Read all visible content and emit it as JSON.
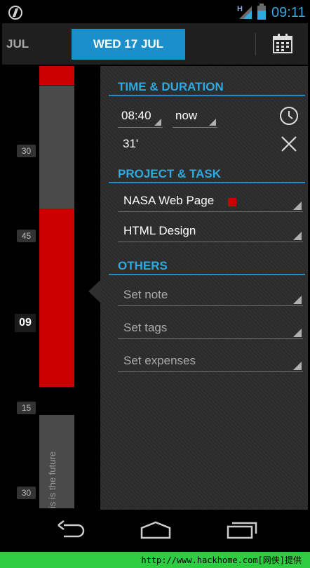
{
  "status_bar": {
    "network": "H",
    "time": "09:11"
  },
  "header": {
    "prev_date": "JUL",
    "current_date": "WED 17 JUL"
  },
  "timeline": {
    "labels": [
      "30",
      "45",
      "09",
      "15",
      "30"
    ],
    "future_text": "is is the future"
  },
  "time_section": {
    "title": "TIME & DURATION",
    "start_time": "08:40",
    "end_time": "now",
    "duration": "31'"
  },
  "project_section": {
    "title": "PROJECT & TASK",
    "project": "NASA Web Page",
    "project_color": "#cc0000",
    "task": "HTML Design"
  },
  "others_section": {
    "title": "OTHERS",
    "note_hint": "Set note",
    "tags_hint": "Set tags",
    "expenses_hint": "Set expenses"
  },
  "watermark": {
    "text": "http://www.hackhome.com[网侠]提供"
  },
  "colors": {
    "accent": "#1a8fc9",
    "block_red": "#cc0000"
  }
}
